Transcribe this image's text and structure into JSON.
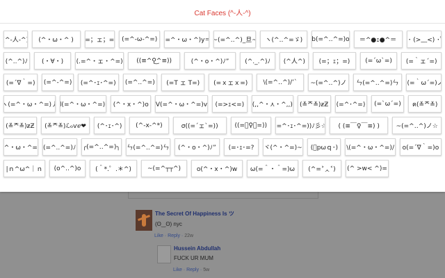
{
  "popup": {
    "title": "Cat Faces (^-人-^)",
    "rows": [
      [
        "(^-人-^)",
        "(^・ω・^ )",
        "(=；ェ；=)",
        "(=^-ω-^=)",
        "(=^・ω・^)y＝",
        "~(=^‥^)_旦~",
        "ヽ(^‥^=ゞ)",
        "b(=^‥^=)o",
        "＝^●ｪ●^＝",
        "｡ﾟ･ (>﹏<) ･ﾟ｡"
      ],
      [
        "(^..^)ﾉ",
        "(・∀・)",
        "(.=^・ェ・^=)",
        "((≡^⚲͜^≡))",
        "(^・o・^)ﾉ”",
        "(^._.^)ﾉ",
        "(^人^)",
        "(=；ｪ；=)",
        "(=´ω`=)",
        "(=｀ェ´=)"
      ],
      [
        "(=´∇｀=)",
        "(=^-^=)",
        "(=^･ｪ･^=)",
        "(=^..^=)",
        "(=T ェ T=)",
        "(=ｘェｘ=)",
        "\\(=^‥^)/’`",
        "~(=^‥^)ノ",
        "ㄣ(=^‥^=)ㄣ",
        "ヾ(=｀ω´=)ノ”"
      ],
      [
        "ヽ(=^・ω・^=)丿",
        "d(=^・ω・^=)b",
        "(^・x・^)o",
        "V(=^・ω・^=)v",
        "(=>ｪ<=)",
        "(,,^・⋏・^,,)",
        "(≚ᄌ≚)ƶƵ",
        "(=^･^=)",
        "(=`ω´=)",
        "ฅ(≚ᄌ≚)"
      ],
      [
        "(≚ᄌ≚)ƶƵ",
        "(≚ᄌ≚)ℒℴѵℯ❤",
        "(^･ｪ･^)",
        "(^-x-^*)",
        "σ((=´ェ`=))",
        "((=ﾟ♀ﾟ=))",
        "(=^･ｪ･^=))ﾉ彡☆",
        "( (≡￣♀￣≡) )",
        "~(=^‥^)ノ☆",
        ""
      ],
      [
        "(=^・ω・^=)~",
        "(=^..^=)ﾉ",
        "╭(=^‥^=)╮",
        "ㄣ(=^..^=)ㄣ",
        "(^・o・^)ﾉ”",
        "(=･ｪ･=?",
        "ヾ(^・^=)~",
        "(ﾟpωｑ･)",
        "\\(=^・ω・^=)/",
        "o(=´∇｀=)o"
      ],
      [
        "|ｎ^ω^｜ｎ",
        "(o^..^)o",
        "(＾*.゜.＊^)",
        "~(=^┬┬^)",
        "o(^・x・^)w",
        "ω(=＾・＾=)ω",
        "(^=˃ᆺ˂)",
        "(^ >w< ^)="
      ]
    ]
  },
  "comments": [
    {
      "author": "The Secret Of Happiness Is ツ",
      "text": "(ʘ‿ʘ) nyc",
      "like": "Like",
      "reply": "Reply",
      "time": "22w"
    },
    {
      "author": "Hussein Abdullah",
      "text": "FUCK UR MUM",
      "like": "Like",
      "reply": "Reply",
      "time": "5w"
    }
  ]
}
